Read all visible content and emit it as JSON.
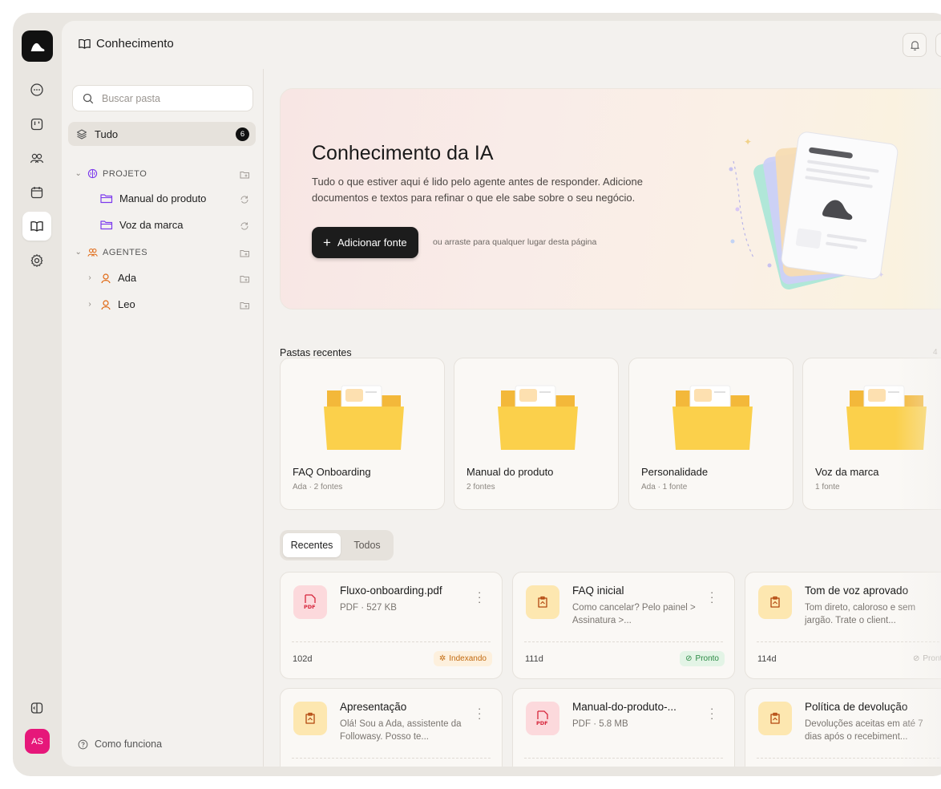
{
  "rail": {
    "avatar_initials": "AS"
  },
  "topbar": {
    "title": "Conhecimento"
  },
  "sidebar": {
    "search_placeholder": "Buscar pasta",
    "all_label": "Tudo",
    "all_count": "6",
    "sections": [
      {
        "label": "PROJETO",
        "items": [
          {
            "label": "Manual do produto"
          },
          {
            "label": "Voz da marca"
          }
        ]
      },
      {
        "label": "AGENTES",
        "items": [
          {
            "label": "Ada"
          },
          {
            "label": "Leo"
          }
        ]
      }
    ],
    "help_label": "Como funciona"
  },
  "hero": {
    "title": "Conhecimento da IA",
    "description": "Tudo o que estiver aqui é lido pelo agente antes de responder. Adicione documentos e textos para refinar o que ele sabe sobre o seu negócio.",
    "add_button": "Adicionar fonte",
    "hint": "ou arraste para qualquer lugar desta página"
  },
  "recent_folders": {
    "label": "Pastas recentes",
    "count": "4",
    "items": [
      {
        "name": "FAQ Onboarding",
        "sub": "Ada · 2 fontes"
      },
      {
        "name": "Manual do produto",
        "sub": "2 fontes"
      },
      {
        "name": "Personalidade",
        "sub": "Ada · 1 fonte"
      },
      {
        "name": "Voz da marca",
        "sub": "1 fonte"
      }
    ]
  },
  "tabs": {
    "recent": "Recentes",
    "all": "Todos"
  },
  "sources": [
    {
      "title": "Fluxo-onboarding.pdf",
      "desc": "PDF · 527 KB",
      "type": "pdf",
      "age": "102d",
      "status": "Indexando"
    },
    {
      "title": "FAQ inicial",
      "desc": "Como cancelar? Pelo painel > Assinatura >...",
      "type": "note",
      "age": "111d",
      "status": "Pronto"
    },
    {
      "title": "Tom de voz aprovado",
      "desc": "Tom direto, caloroso e sem jargão. Trate o client...",
      "type": "note",
      "age": "114d",
      "status": "Pronto"
    },
    {
      "title": "Apresentação",
      "desc": "Olá! Sou a Ada, assistente da Followasy. Posso te...",
      "type": "note"
    },
    {
      "title": "Manual-do-produto-...",
      "desc": "PDF · 5.8 MB",
      "type": "pdf"
    },
    {
      "title": "Política de devolução",
      "desc": "Devoluções aceitas em até 7 dias após o recebiment...",
      "type": "note"
    }
  ]
}
